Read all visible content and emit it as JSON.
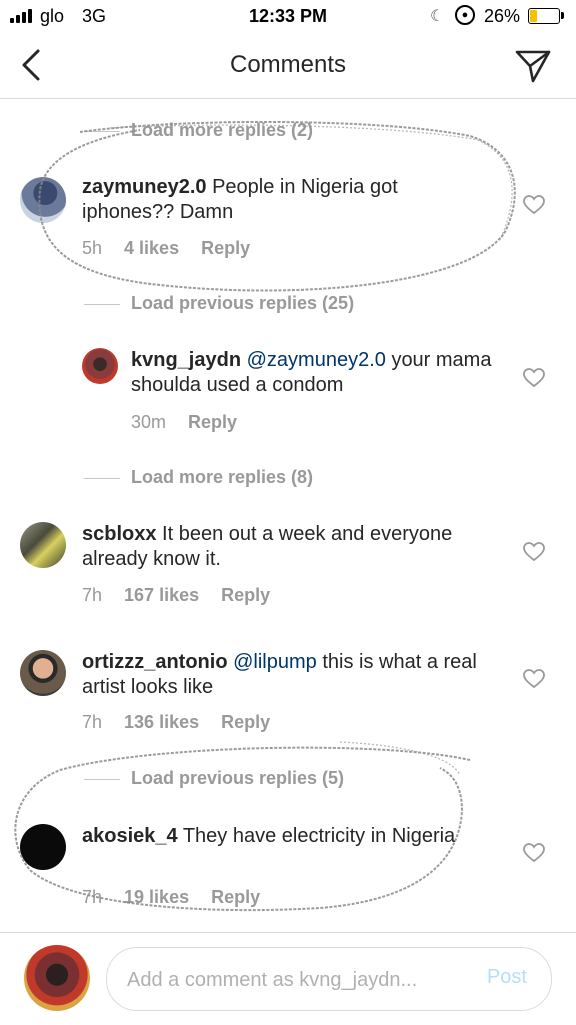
{
  "status_bar": {
    "carrier": "glo",
    "network": "3G",
    "time": "12:33 PM",
    "battery_percent": "26%",
    "battery_level": 0.26,
    "icons": [
      "signal-icon",
      "moon-icon",
      "orientation-lock-icon",
      "battery-icon"
    ]
  },
  "header": {
    "title": "Comments",
    "back_icon": "chevron-left-icon",
    "share_icon": "paper-plane-icon"
  },
  "threads": {
    "load_more_top": "Load more replies (2)",
    "load_previous_1": "Load previous replies (25)",
    "load_more_2": "Load more replies (8)",
    "load_previous_2": "Load previous replies (5)"
  },
  "comments": [
    {
      "username": "zaymuney2.0",
      "text": "People in Nigeria got iphones?? Damn",
      "time": "5h",
      "likes": "4 likes",
      "reply": "Reply"
    },
    {
      "username": "kvng_jaydn",
      "mention": "@zaymuney2.0",
      "text": "your mama shoulda used a condom",
      "time": "30m",
      "likes": "",
      "reply": "Reply"
    },
    {
      "username": "scbloxx",
      "text": "It been out a week and everyone already know it.",
      "time": "7h",
      "likes": "167 likes",
      "reply": "Reply"
    },
    {
      "username": "ortizzz_antonio",
      "mention": "@lilpump",
      "text": " this is what a real artist looks like",
      "time": "7h",
      "likes": "136 likes",
      "reply": "Reply"
    },
    {
      "username": "akosiek_4",
      "text": "They have electricity in Nigeria",
      "time": "7h",
      "likes": "19 likes",
      "reply": "Reply"
    }
  ],
  "composer": {
    "placeholder": "Add a comment as kvng_jaydn...",
    "post_label": "Post"
  },
  "colors": {
    "text": "#262626",
    "muted": "#999999",
    "mention": "#003569",
    "post_disabled": "#b2dffc",
    "divider": "#dbdbdb",
    "battery": "#f5c400"
  }
}
